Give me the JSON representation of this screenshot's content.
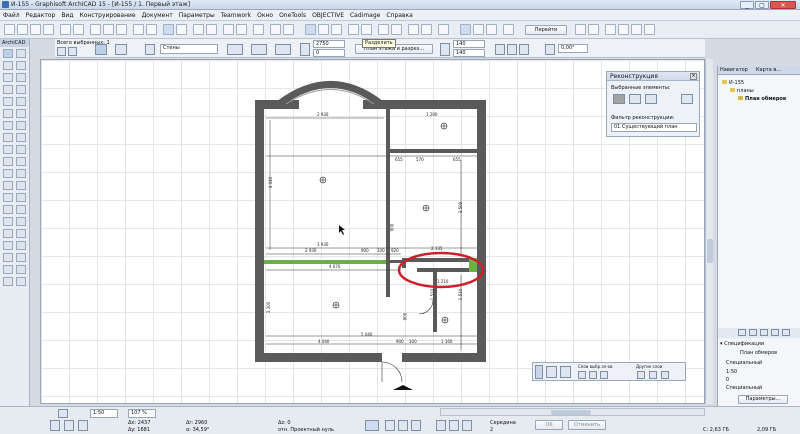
{
  "window": {
    "title": "И-155 - Graphisoft ArchiCAD 15 - [И-155 / 1. Первый этаж]",
    "controls": [
      "_",
      "▢",
      "✕"
    ]
  },
  "menu": [
    "Файл",
    "Редактор",
    "Вид",
    "Конструирование",
    "Документ",
    "Параметры",
    "Teamwork",
    "Окно",
    "OneTools",
    "OBJECTIVE",
    "Cadimage",
    "Справка"
  ],
  "toolbar": {
    "tooltip": "Разделить",
    "goto_label": "Перейти"
  },
  "infobox": {
    "all_selected": "Всего выбранных: 1",
    "layer_value": "Стены",
    "dim1": "2750",
    "dim2": "0",
    "dim3": "140",
    "dim4": "140",
    "plan_button": "План этажа и разрез...",
    "angle": "0,00°"
  },
  "toolbox": {
    "title": "ArchiCAD"
  },
  "plan": {
    "dims": {
      "top_left": "2 930",
      "top_right": "1 200",
      "left_side": "4 040",
      "mid_row1a": "655",
      "mid_row1b": "570",
      "mid_row1c": "655",
      "mid_total": "3 930",
      "mid_left": "2 930",
      "mid_a": "900",
      "mid_b": "100",
      "mid_c": "920",
      "green": "4 670",
      "mid_d": "2 135",
      "hall": "1 210",
      "bottom_total": "5 040",
      "bottom_left": "4 040",
      "bottom_a": "900",
      "bottom_b": "100",
      "bottom_c": "1 160",
      "left_low": "3 300",
      "right_mid": "3 500",
      "right_low": "1 510",
      "right_low2": "900",
      "small_v": "900",
      "small_v2": "1 510"
    }
  },
  "reconstruction": {
    "title": "Реконструкция",
    "selected_label": "Выбранные элементы:",
    "filter_label": "Фильтр реконструкции:",
    "filter_value": "01 Существующий план"
  },
  "mini_toolbar": {
    "layers_label": "Слои выбр.эл-ов",
    "other_label": "Другие слои"
  },
  "navigator": {
    "tab1": "Навигатор",
    "tab2": "Карта в...",
    "tree": [
      "И-155",
      "планы",
      "План обмеров"
    ],
    "spec_section": "Спецификации",
    "spec_value": "План обмеров",
    "rows": [
      "Специальный",
      "1:50",
      "0",
      "Специальный"
    ],
    "params_button": "Параметры..."
  },
  "status": {
    "scale": "1:50",
    "zoom": "107 %",
    "dx": "Δx: 2437",
    "dy": "Δy: 1681",
    "da": "Δr: 2960",
    "angle": "α: 34,59°",
    "dz": "Δz: 0",
    "origin": "отн. Проектный нуль",
    "snap_label": "Середина",
    "snap_value": "2",
    "ok": "OK",
    "cancel": "Отменить",
    "disk1": "C: 2,63 ГБ",
    "disk2": "2,09 ГБ"
  },
  "colors": {
    "annotation_red": "#cc1f2b",
    "green_wall": "#6cb04a",
    "wall_dark": "#5a5a5a"
  }
}
